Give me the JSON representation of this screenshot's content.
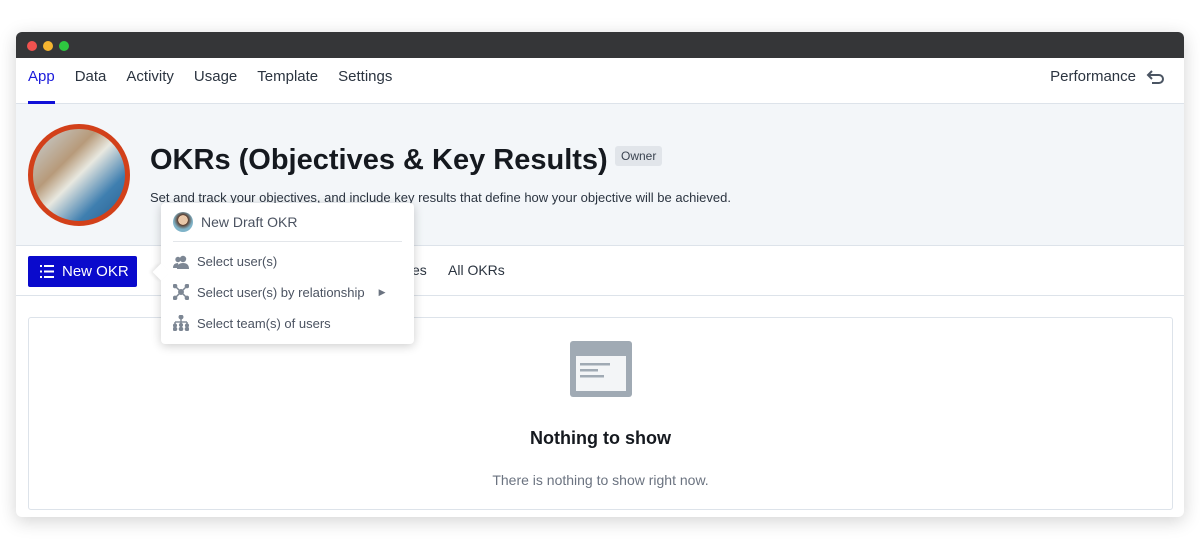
{
  "window": {
    "controls": [
      "close",
      "minimize",
      "maximize"
    ]
  },
  "nav": {
    "tabs": [
      {
        "label": "App",
        "active": true
      },
      {
        "label": "Data"
      },
      {
        "label": "Activity"
      },
      {
        "label": "Usage"
      },
      {
        "label": "Template"
      },
      {
        "label": "Settings"
      }
    ],
    "right_label": "Performance",
    "right_icon": "undo-icon"
  },
  "header": {
    "title": "OKRs (Objectives & Key Results)",
    "badge": "Owner",
    "description": "Set and track your objectives, and include key results that define how your objective will be achieved."
  },
  "toolbar": {
    "new_button": "New OKR",
    "hidden_tab_fragment": "es",
    "all_tab": "All OKRs"
  },
  "menu": {
    "items": [
      {
        "label": "New Draft OKR",
        "icon": "user-avatar"
      },
      {
        "label": "Select user(s)",
        "icon": "users-icon"
      },
      {
        "label": "Select user(s) by relationship",
        "icon": "relationship-icon",
        "submenu": true
      },
      {
        "label": "Select team(s) of users",
        "icon": "team-hierarchy-icon"
      }
    ]
  },
  "empty": {
    "title": "Nothing to show",
    "subtitle": "There is nothing to show right now."
  },
  "colors": {
    "accent": "#0a0acc",
    "avatar_ring": "#d2401a"
  }
}
